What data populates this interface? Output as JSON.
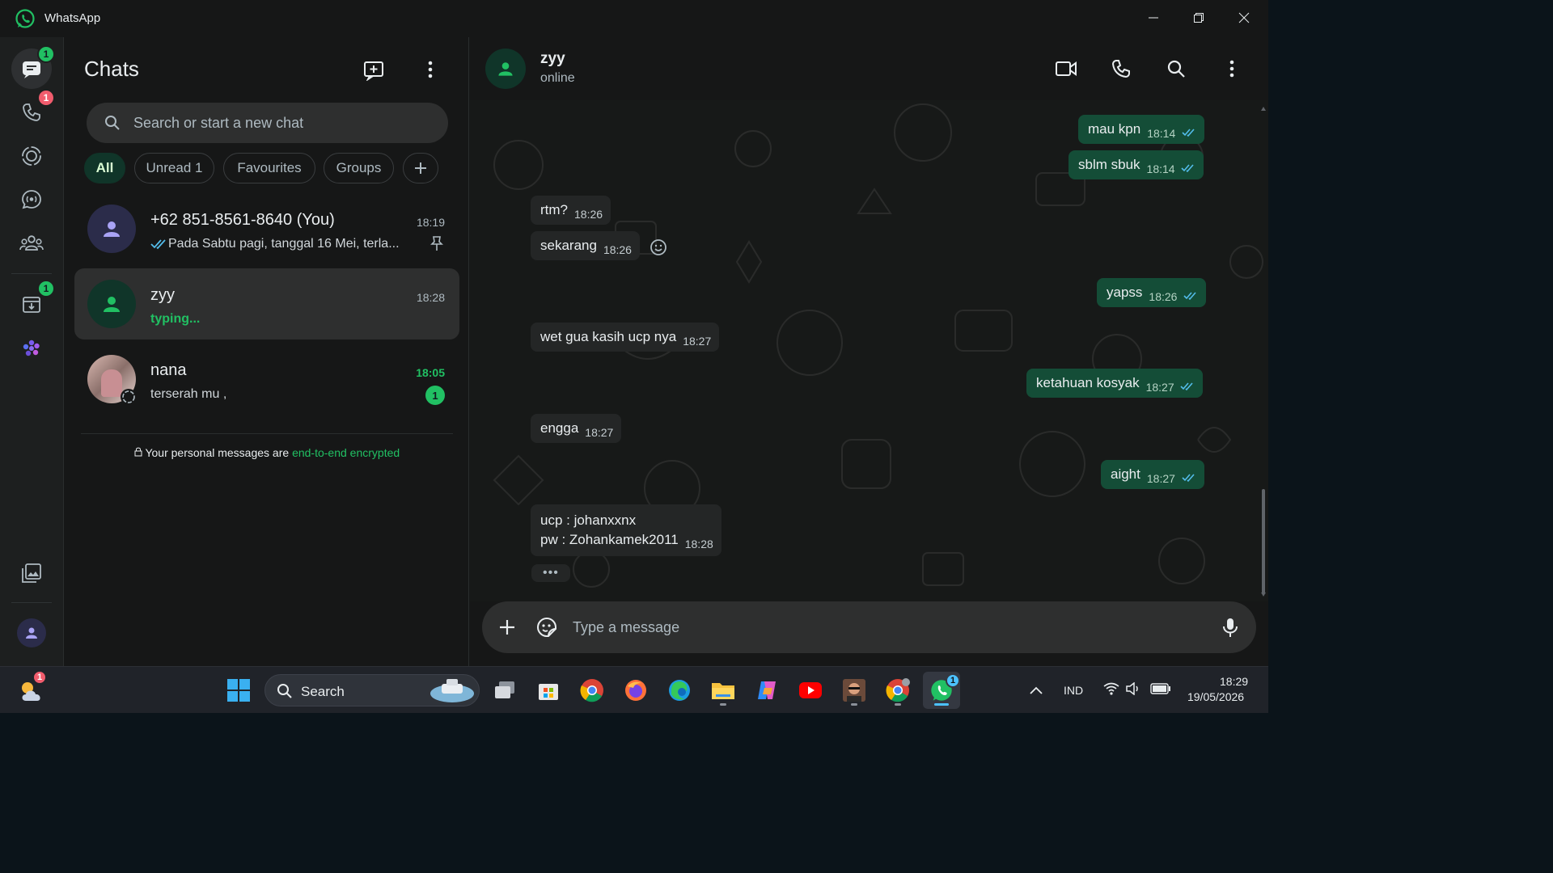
{
  "window": {
    "title": "WhatsApp"
  },
  "rail": {
    "chats_badge": "1",
    "calls_badge": "1",
    "archive_badge": "1"
  },
  "chat_list": {
    "title": "Chats",
    "search_placeholder": "Search or start a new chat",
    "filters": [
      "All",
      "Unread 1",
      "Favourites",
      "Groups"
    ],
    "chats": [
      {
        "name": "+62 851-8561-8640 (You)",
        "time": "18:19",
        "preview": "Pada Sabtu pagi, tanggal 16 Mei, terla..."
      },
      {
        "name": "zyy",
        "time": "18:28",
        "preview": "typing..."
      },
      {
        "name": "nana",
        "time": "18:05",
        "preview": "terserah mu ,",
        "unread": "1"
      }
    ],
    "e2e_text": "Your personal messages are ",
    "e2e_link": "end-to-end encrypted"
  },
  "conversation": {
    "name": "zyy",
    "status": "online",
    "messages": [
      {
        "dir": "out",
        "text": "mau kpn",
        "time": "18:14"
      },
      {
        "dir": "out",
        "text": "sblm sbuk",
        "time": "18:14"
      },
      {
        "dir": "in",
        "text": "rtm?",
        "time": "18:26"
      },
      {
        "dir": "in",
        "text": "sekarang",
        "time": "18:26"
      },
      {
        "dir": "out",
        "text": "yapss",
        "time": "18:26"
      },
      {
        "dir": "in",
        "text": "wet gua kasih ucp nya",
        "time": "18:27"
      },
      {
        "dir": "out",
        "text": "ketahuan kosyak",
        "time": "18:27"
      },
      {
        "dir": "in",
        "text": "engga",
        "time": "18:27"
      },
      {
        "dir": "out",
        "text": "aight",
        "time": "18:27"
      },
      {
        "dir": "in",
        "text": "ucp : johanxxnx",
        "text2": "pw : Zohankamek2011",
        "time": "18:28"
      }
    ],
    "typing_indicator": "•••",
    "composer_placeholder": "Type a message"
  },
  "taskbar": {
    "search_label": "Search",
    "weather_badge": "1",
    "whatsapp_badge": "1",
    "language": "IND",
    "time": "18:29",
    "date": "19/05/2026"
  },
  "colors": {
    "accent_green": "#21c063",
    "outgoing_bubble": "#144d37",
    "incoming_bubble": "#242626",
    "unread_red": "#f15c6d"
  }
}
